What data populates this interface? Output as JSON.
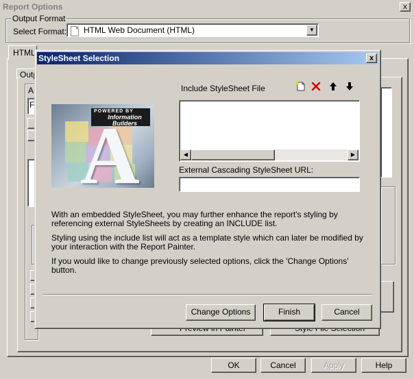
{
  "window": {
    "title": "Report Options",
    "close_label": "x"
  },
  "output_format": {
    "group_label": "Output Format",
    "select_label": "Select Format:",
    "selected_value": "HTML Web Document (HTML)"
  },
  "background": {
    "tab_html_label": "HTML",
    "inner_tab_label": "Outp",
    "box_label": "A",
    "field_letter": "F",
    "painter_button_label": "Preview in Painter",
    "style_file_button_label": "Style File Selection"
  },
  "footer": {
    "ok_label": "OK",
    "cancel_label": "Cancel",
    "apply_label": "Apply",
    "help_label": "Help"
  },
  "dialog": {
    "title": "StyleSheet Selection",
    "close_label": "x",
    "logo": {
      "powered_by": "POWERED BY",
      "brand": "Information Builders",
      "letter": "A"
    },
    "include_label": "Include StyleSheet File",
    "toolbar_icons": [
      "new-file-icon",
      "delete-icon",
      "move-up-icon",
      "move-down-icon"
    ],
    "include_items": [],
    "css_url_label": "External Cascading StyleSheet URL:",
    "css_url_value": "",
    "info_1": "With an embedded StyleSheet, you may further enhance the report's styling by referencing external StyleSheets by creating an INCLUDE list.",
    "info_2": "Styling using the include list will act as a template style which can later be modified by your interaction with the Report Painter.",
    "info_3": "If you would like to change previously selected options, click the 'Change Options' button.",
    "buttons": {
      "change_options": "Change Options",
      "finish": "Finish",
      "cancel": "Cancel"
    }
  },
  "colors": {
    "title_gradient_start": "#0a246a",
    "title_gradient_end": "#a6caf0",
    "face": "#d4d0c8"
  }
}
